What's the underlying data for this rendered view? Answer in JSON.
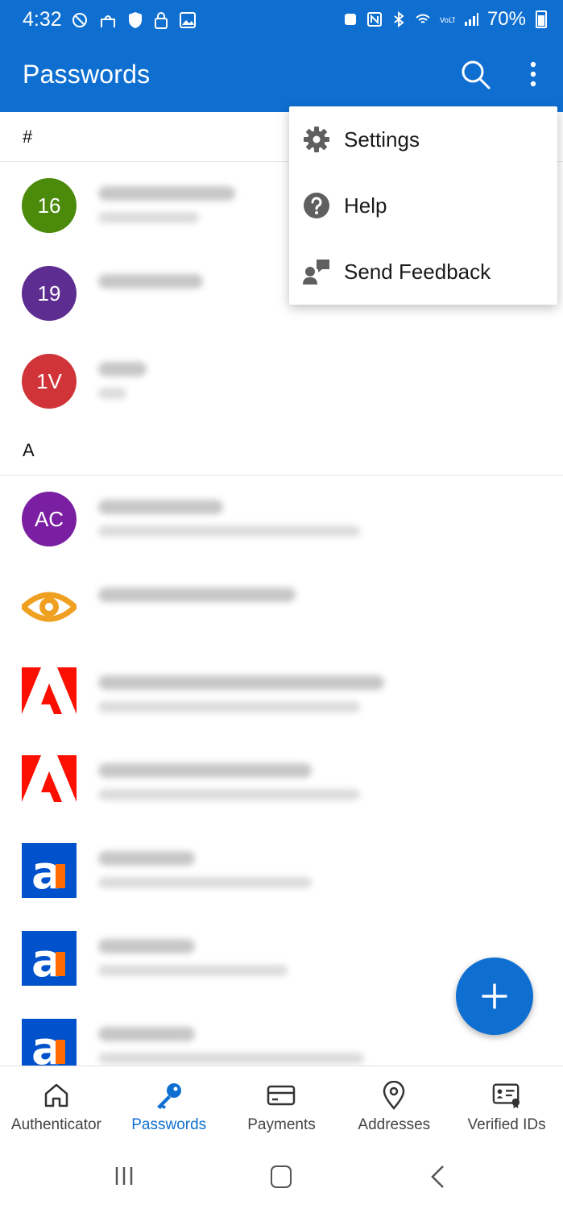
{
  "status_bar": {
    "time": "4:32",
    "battery": "70%"
  },
  "header": {
    "title": "Passwords",
    "search_icon": "search-icon",
    "more_icon": "more-vertical-icon"
  },
  "sections": [
    {
      "header": "#",
      "items": [
        {
          "avatar": "16",
          "color": "#4c8a0b"
        },
        {
          "avatar": "19",
          "color": "#5e2d91"
        },
        {
          "avatar": "1V",
          "color": "#d13438"
        }
      ]
    },
    {
      "header": "A",
      "items": [
        {
          "avatar": "AC",
          "color": "#7b1fa2"
        },
        {
          "logo": "aperture-logo"
        },
        {
          "logo": "adobe-logo"
        },
        {
          "logo": "adobe-logo"
        },
        {
          "logo": "a-orange-logo"
        },
        {
          "logo": "a-orange-logo"
        },
        {
          "logo": "a-orange-logo"
        }
      ]
    }
  ],
  "menu": {
    "items": [
      {
        "label": "Settings",
        "icon": "gear-icon"
      },
      {
        "label": "Help",
        "icon": "help-circle-icon"
      },
      {
        "label": "Send Feedback",
        "icon": "feedback-icon"
      }
    ]
  },
  "fab": {
    "icon": "plus-icon"
  },
  "bottom_nav": {
    "items": [
      {
        "label": "Authenticator",
        "icon": "home-icon",
        "active": false
      },
      {
        "label": "Passwords",
        "icon": "key-icon",
        "active": true
      },
      {
        "label": "Payments",
        "icon": "card-icon",
        "active": false
      },
      {
        "label": "Addresses",
        "icon": "location-pin-icon",
        "active": false
      },
      {
        "label": "Verified IDs",
        "icon": "id-card-icon",
        "active": false
      }
    ]
  },
  "colors": {
    "accent": "#0f6fd1",
    "adobe_red": "#fa0f00",
    "a_blue": "#0052cc",
    "a_orange": "#ff6a00",
    "aperture_orange": "#f0a020"
  }
}
